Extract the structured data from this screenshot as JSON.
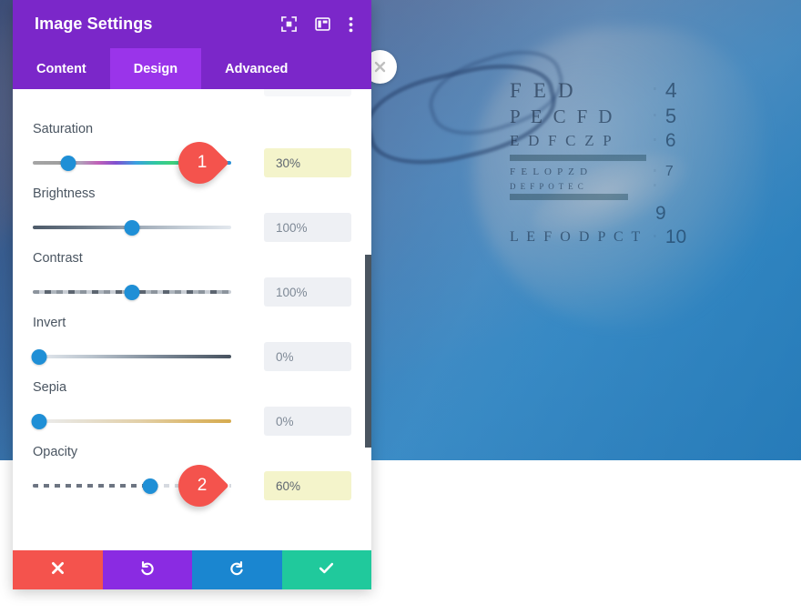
{
  "panel": {
    "title": "Image Settings",
    "header_icons": [
      {
        "name": "focus-target-icon"
      },
      {
        "name": "layout-panel-icon"
      },
      {
        "name": "more-options-icon"
      }
    ],
    "tabs": [
      {
        "label": "Content",
        "active": false
      },
      {
        "label": "Design",
        "active": true
      },
      {
        "label": "Advanced",
        "active": false
      }
    ],
    "controls": [
      {
        "label": "Saturation",
        "value": "30%",
        "fill": 18,
        "highlight": true,
        "marker": "1",
        "track": "sat"
      },
      {
        "label": "Brightness",
        "value": "100%",
        "fill": 50,
        "highlight": false,
        "marker": "",
        "track": "bri"
      },
      {
        "label": "Contrast",
        "value": "100%",
        "fill": 50,
        "highlight": false,
        "marker": "",
        "track": "con"
      },
      {
        "label": "Invert",
        "value": "0%",
        "fill": 3,
        "highlight": false,
        "marker": "",
        "track": "inv"
      },
      {
        "label": "Sepia",
        "value": "0%",
        "fill": 3,
        "highlight": false,
        "marker": "",
        "track": "sep"
      },
      {
        "label": "Opacity",
        "value": "60%",
        "fill": 59,
        "highlight": true,
        "marker": "2",
        "track": "opa"
      }
    ],
    "footer_buttons": [
      {
        "name": "cancel-button",
        "icon": "close-x-icon",
        "color": "#f4534d"
      },
      {
        "name": "undo-button",
        "icon": "undo-arrow-icon",
        "color": "#8a2be2"
      },
      {
        "name": "redo-button",
        "icon": "redo-arrow-icon",
        "color": "#1a86d0"
      },
      {
        "name": "save-button",
        "icon": "checkmark-icon",
        "color": "#20c99c"
      }
    ]
  },
  "image": {
    "close_icon": "close-circle-icon",
    "eye_chart": {
      "rows": [
        {
          "letters": "F E D",
          "number": "4",
          "bar": false
        },
        {
          "letters": "P E C F D",
          "number": "5",
          "bar": false
        },
        {
          "letters": "E D F C Z P",
          "number": "6",
          "bar": false
        },
        {
          "letters": "",
          "number": "",
          "bar": true
        },
        {
          "letters": "F E L O P Z D",
          "number": "7",
          "bar": false
        },
        {
          "letters": "D E F P O T E C",
          "number": "",
          "bar": false
        },
        {
          "letters": "",
          "number": "9",
          "bar": true
        },
        {
          "letters": "L E F O D P C T",
          "number": "10",
          "bar": false
        }
      ]
    }
  },
  "colors": {
    "panel_purple": "#7b27c9",
    "tab_active_purple": "#9a34ea",
    "knob_blue": "#1f8fd6",
    "marker_red": "#f4534d",
    "highlight_yellow": "#f4f4cb",
    "input_gray": "#eef0f4"
  }
}
